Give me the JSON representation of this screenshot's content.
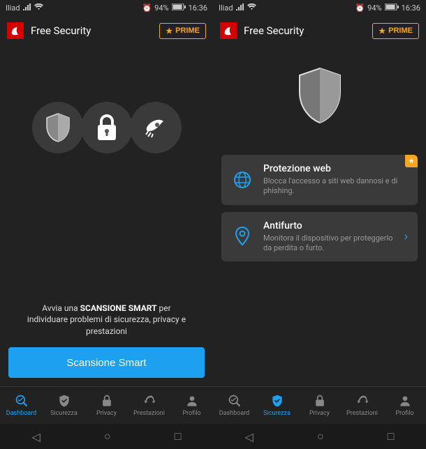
{
  "status": {
    "carrier": "Iliad",
    "battery": "94%",
    "time": "16:36"
  },
  "header": {
    "title": "Free Security",
    "prime_label": "PRIME"
  },
  "dashboard": {
    "hint_prefix": "Avvia una ",
    "hint_strong": "SCANSIONE SMART",
    "hint_suffix": " per individuare problemi di sicurezza, privacy e prestazioni",
    "cta_label": "Scansione Smart"
  },
  "security": {
    "cards": [
      {
        "title": "Protezione web",
        "desc": "Blocca l'accesso a siti web dannosi e di phishing.",
        "premium": true
      },
      {
        "title": "Antifurto",
        "desc": "Monitora il dispositivo per proteggerlo da perdita o furto.",
        "premium": false
      }
    ]
  },
  "nav": {
    "items": [
      {
        "label": "Dashboard"
      },
      {
        "label": "Sicurezza"
      },
      {
        "label": "Privacy"
      },
      {
        "label": "Prestazioni"
      },
      {
        "label": "Profilo"
      }
    ]
  }
}
